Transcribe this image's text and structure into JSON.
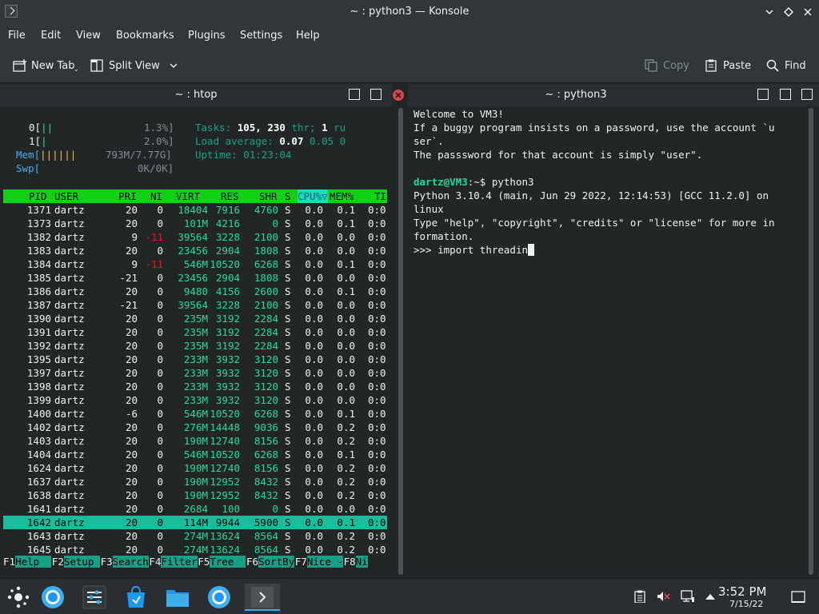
{
  "window": {
    "title": "~ : python3 — Konsole"
  },
  "menu": [
    "File",
    "Edit",
    "View",
    "Bookmarks",
    "Plugins",
    "Settings",
    "Help"
  ],
  "toolbar": {
    "new_tab": "New Tab",
    "split_view": "Split View",
    "copy": "Copy",
    "paste": "Paste",
    "find": "Find"
  },
  "left_pane": {
    "title": "~ : htop",
    "meters": {
      "cpu0_label": "0[",
      "cpu0_bar": "||",
      "cpu0_value": "1.3%]",
      "cpu1_label": "1[",
      "cpu1_bar": "|",
      "cpu1_value": "2.0%]",
      "mem_label": "Mem[",
      "mem_bar": "||||||",
      "mem_value": "793M/7.77G]",
      "swp_label": "Swp[",
      "swp_value": "0K/0K]",
      "tasks_label": "Tasks:",
      "tasks_procs": "105,",
      "tasks_threads": "230",
      "tasks_thr_label": "thr;",
      "tasks_running": "1",
      "tasks_ru": "ru",
      "load_label": "Load average:",
      "load_1": "0.07",
      "load_5": "0.05",
      "load_15": "0",
      "uptime_label": "Uptime:",
      "uptime_value": "01:23:04"
    },
    "columns": [
      "PID",
      "USER",
      "PRI",
      "NI",
      "VIRT",
      "RES",
      "SHR",
      "S",
      "CPU%▽",
      "MEM%",
      "TI"
    ],
    "processes": [
      {
        "pid": "1371",
        "user": "dartz",
        "pri": "20",
        "ni": "0",
        "virt": "18404",
        "res": "7916",
        "shr": "4760",
        "s": "S",
        "cpu": "0.0",
        "mem": "0.1",
        "time": "0:0"
      },
      {
        "pid": "1373",
        "user": "dartz",
        "pri": "20",
        "ni": "0",
        "virt": "101M",
        "res": "4216",
        "shr": "0",
        "s": "S",
        "cpu": "0.0",
        "mem": "0.1",
        "time": "0:0"
      },
      {
        "pid": "1382",
        "user": "dartz",
        "pri": "9",
        "ni": "-11",
        "virt": "39564",
        "res": "3228",
        "shr": "2100",
        "s": "S",
        "cpu": "0.0",
        "mem": "0.0",
        "time": "0:0"
      },
      {
        "pid": "1383",
        "user": "dartz",
        "pri": "20",
        "ni": "0",
        "virt": "23456",
        "res": "2904",
        "shr": "1808",
        "s": "S",
        "cpu": "0.0",
        "mem": "0.0",
        "time": "0:0"
      },
      {
        "pid": "1384",
        "user": "dartz",
        "pri": "9",
        "ni": "-11",
        "virt": "546M",
        "res": "10520",
        "shr": "6268",
        "s": "S",
        "cpu": "0.0",
        "mem": "0.1",
        "time": "0:0"
      },
      {
        "pid": "1385",
        "user": "dartz",
        "pri": "-21",
        "ni": "0",
        "virt": "23456",
        "res": "2904",
        "shr": "1808",
        "s": "S",
        "cpu": "0.0",
        "mem": "0.0",
        "time": "0:0"
      },
      {
        "pid": "1386",
        "user": "dartz",
        "pri": "20",
        "ni": "0",
        "virt": "9480",
        "res": "4156",
        "shr": "2600",
        "s": "S",
        "cpu": "0.0",
        "mem": "0.1",
        "time": "0:0"
      },
      {
        "pid": "1387",
        "user": "dartz",
        "pri": "-21",
        "ni": "0",
        "virt": "39564",
        "res": "3228",
        "shr": "2100",
        "s": "S",
        "cpu": "0.0",
        "mem": "0.0",
        "time": "0:0"
      },
      {
        "pid": "1390",
        "user": "dartz",
        "pri": "20",
        "ni": "0",
        "virt": "235M",
        "res": "3192",
        "shr": "2284",
        "s": "S",
        "cpu": "0.0",
        "mem": "0.0",
        "time": "0:0"
      },
      {
        "pid": "1391",
        "user": "dartz",
        "pri": "20",
        "ni": "0",
        "virt": "235M",
        "res": "3192",
        "shr": "2284",
        "s": "S",
        "cpu": "0.0",
        "mem": "0.0",
        "time": "0:0"
      },
      {
        "pid": "1392",
        "user": "dartz",
        "pri": "20",
        "ni": "0",
        "virt": "235M",
        "res": "3192",
        "shr": "2284",
        "s": "S",
        "cpu": "0.0",
        "mem": "0.0",
        "time": "0:0"
      },
      {
        "pid": "1395",
        "user": "dartz",
        "pri": "20",
        "ni": "0",
        "virt": "233M",
        "res": "3932",
        "shr": "3120",
        "s": "S",
        "cpu": "0.0",
        "mem": "0.0",
        "time": "0:0"
      },
      {
        "pid": "1397",
        "user": "dartz",
        "pri": "20",
        "ni": "0",
        "virt": "233M",
        "res": "3932",
        "shr": "3120",
        "s": "S",
        "cpu": "0.0",
        "mem": "0.0",
        "time": "0:0"
      },
      {
        "pid": "1398",
        "user": "dartz",
        "pri": "20",
        "ni": "0",
        "virt": "233M",
        "res": "3932",
        "shr": "3120",
        "s": "S",
        "cpu": "0.0",
        "mem": "0.0",
        "time": "0:0"
      },
      {
        "pid": "1399",
        "user": "dartz",
        "pri": "20",
        "ni": "0",
        "virt": "233M",
        "res": "3932",
        "shr": "3120",
        "s": "S",
        "cpu": "0.0",
        "mem": "0.0",
        "time": "0:0"
      },
      {
        "pid": "1400",
        "user": "dartz",
        "pri": "-6",
        "ni": "0",
        "virt": "546M",
        "res": "10520",
        "shr": "6268",
        "s": "S",
        "cpu": "0.0",
        "mem": "0.1",
        "time": "0:0"
      },
      {
        "pid": "1402",
        "user": "dartz",
        "pri": "20",
        "ni": "0",
        "virt": "276M",
        "res": "14448",
        "shr": "9036",
        "s": "S",
        "cpu": "0.0",
        "mem": "0.2",
        "time": "0:0"
      },
      {
        "pid": "1403",
        "user": "dartz",
        "pri": "20",
        "ni": "0",
        "virt": "190M",
        "res": "12740",
        "shr": "8156",
        "s": "S",
        "cpu": "0.0",
        "mem": "0.2",
        "time": "0:0"
      },
      {
        "pid": "1404",
        "user": "dartz",
        "pri": "20",
        "ni": "0",
        "virt": "546M",
        "res": "10520",
        "shr": "6268",
        "s": "S",
        "cpu": "0.0",
        "mem": "0.1",
        "time": "0:0"
      },
      {
        "pid": "1624",
        "user": "dartz",
        "pri": "20",
        "ni": "0",
        "virt": "190M",
        "res": "12740",
        "shr": "8156",
        "s": "S",
        "cpu": "0.0",
        "mem": "0.2",
        "time": "0:0"
      },
      {
        "pid": "1637",
        "user": "dartz",
        "pri": "20",
        "ni": "0",
        "virt": "190M",
        "res": "12952",
        "shr": "8432",
        "s": "S",
        "cpu": "0.0",
        "mem": "0.2",
        "time": "0:0"
      },
      {
        "pid": "1638",
        "user": "dartz",
        "pri": "20",
        "ni": "0",
        "virt": "190M",
        "res": "12952",
        "shr": "8432",
        "s": "S",
        "cpu": "0.0",
        "mem": "0.2",
        "time": "0:0"
      },
      {
        "pid": "1641",
        "user": "dartz",
        "pri": "20",
        "ni": "0",
        "virt": "2684",
        "res": "100",
        "shr": "0",
        "s": "S",
        "cpu": "0.0",
        "mem": "0.0",
        "time": "0:0"
      },
      {
        "pid": "1642",
        "user": "dartz",
        "pri": "20",
        "ni": "0",
        "virt": "114M",
        "res": "9944",
        "shr": "5900",
        "s": "S",
        "cpu": "0.0",
        "mem": "0.1",
        "time": "0:0",
        "selected": true
      },
      {
        "pid": "1643",
        "user": "dartz",
        "pri": "20",
        "ni": "0",
        "virt": "274M",
        "res": "13624",
        "shr": "8564",
        "s": "S",
        "cpu": "0.0",
        "mem": "0.2",
        "time": "0:0"
      },
      {
        "pid": "1645",
        "user": "dartz",
        "pri": "20",
        "ni": "0",
        "virt": "274M",
        "res": "13624",
        "shr": "8564",
        "s": "S",
        "cpu": "0.0",
        "mem": "0.2",
        "time": "0:0"
      }
    ],
    "fkeys": [
      {
        "key": "F1",
        "label": "Help  "
      },
      {
        "key": "F2",
        "label": "Setup "
      },
      {
        "key": "F3",
        "label": "Search"
      },
      {
        "key": "F4",
        "label": "Filter"
      },
      {
        "key": "F5",
        "label": "Tree  "
      },
      {
        "key": "F6",
        "label": "SortBy"
      },
      {
        "key": "F7",
        "label": "Nice -"
      },
      {
        "key": "F8",
        "label": "Ni"
      }
    ]
  },
  "right_pane": {
    "title": "~ : python3",
    "lines": [
      "Welcome to VM3!",
      "If a buggy program insists on a password, use the account `u",
      "ser`.",
      "The passsword for that account is simply \"user\".",
      "",
      "",
      "Python 3.10.4 (main, Jun 29 2022, 12:14:53) [GCC 11.2.0] on",
      "linux",
      "Type \"help\", \"copyright\", \"credits\" or \"license\" for more in",
      "formation."
    ],
    "prompt_user": "dartz@VM3",
    "prompt_path": ":~$",
    "prompt_command": " python3",
    "repl_prompt": ">>> ",
    "repl_input": "import threadin"
  },
  "taskbar": {
    "time": "3:52 PM",
    "date": "7/15/22"
  },
  "colors": {
    "accent": "#3daee9",
    "htop_header": "#11d116",
    "htop_selected": "#1abc9c",
    "prompt_green": "#1cdc9a"
  }
}
